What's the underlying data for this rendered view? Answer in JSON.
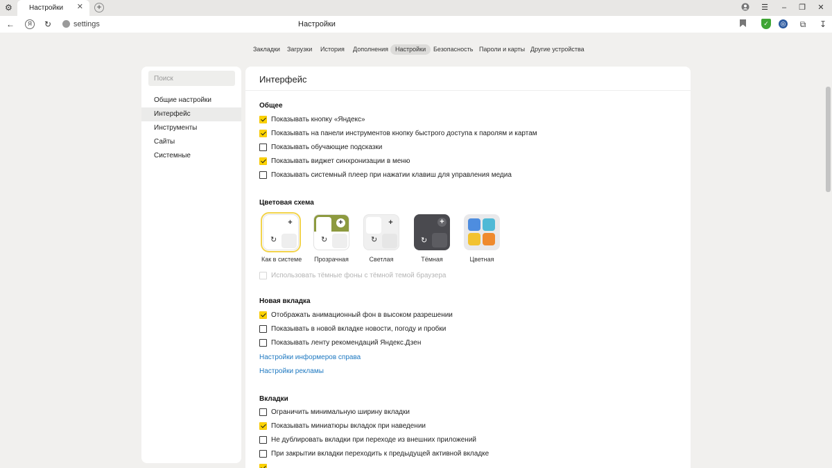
{
  "browser": {
    "tab_title": "Настройки",
    "url": "settings",
    "page_title": "Настройки"
  },
  "topnav": {
    "items": [
      {
        "label": "Закладки"
      },
      {
        "label": "Загрузки"
      },
      {
        "label": "История"
      },
      {
        "label": "Дополнения"
      },
      {
        "label": "Настройки",
        "active": true
      },
      {
        "label": "Безопасность"
      },
      {
        "label": "Пароли и карты"
      },
      {
        "label": "Другие устройства"
      }
    ]
  },
  "sidebar": {
    "search_placeholder": "Поиск",
    "items": [
      {
        "label": "Общие настройки"
      },
      {
        "label": "Интерфейс",
        "active": true
      },
      {
        "label": "Инструменты"
      },
      {
        "label": "Сайты"
      },
      {
        "label": "Системные"
      }
    ]
  },
  "main": {
    "title": "Интерфейс",
    "general": {
      "title": "Общее",
      "options": [
        {
          "label": "Показывать кнопку «Яндекс»",
          "checked": true
        },
        {
          "label": "Показывать на панели инструментов кнопку быстрого доступа к паролям и картам",
          "checked": true
        },
        {
          "label": "Показывать обучающие подсказки",
          "checked": false
        },
        {
          "label": "Показывать виджет синхронизации в меню",
          "checked": true
        },
        {
          "label": "Показывать системный плеер при нажатии клавиш для управления медиа",
          "checked": false
        }
      ]
    },
    "color_scheme": {
      "title": "Цветовая схема",
      "themes": [
        {
          "label": "Как в системе",
          "selected": true
        },
        {
          "label": "Прозрачная"
        },
        {
          "label": "Светлая"
        },
        {
          "label": "Тёмная"
        },
        {
          "label": "Цветная"
        }
      ],
      "dark_bg_option": {
        "label": "Использовать тёмные фоны с тёмной темой браузера",
        "checked": false,
        "disabled": true
      }
    },
    "new_tab": {
      "title": "Новая вкладка",
      "options": [
        {
          "label": "Отображать анимационный фон в высоком разрешении",
          "checked": true
        },
        {
          "label": "Показывать в новой вкладке новости, погоду и пробки",
          "checked": false
        },
        {
          "label": "Показывать ленту рекомендаций Яндекс.Дзен",
          "checked": false
        }
      ],
      "links": [
        "Настройки информеров справа",
        "Настройки рекламы"
      ]
    },
    "tabs": {
      "title": "Вкладки",
      "options": [
        {
          "label": "Ограничить минимальную ширину вкладки",
          "checked": false
        },
        {
          "label": "Показывать миниатюры вкладок при наведении",
          "checked": true
        },
        {
          "label": "Не дублировать вкладки при переходе из внешних приложений",
          "checked": false
        },
        {
          "label": "При закрытии вкладки переходить к предыдущей активной вкладке",
          "checked": false
        }
      ]
    }
  },
  "colors": {
    "accent_yellow": "#fcd300",
    "link_blue": "#1d78c1",
    "shield_green": "#3fa535"
  }
}
